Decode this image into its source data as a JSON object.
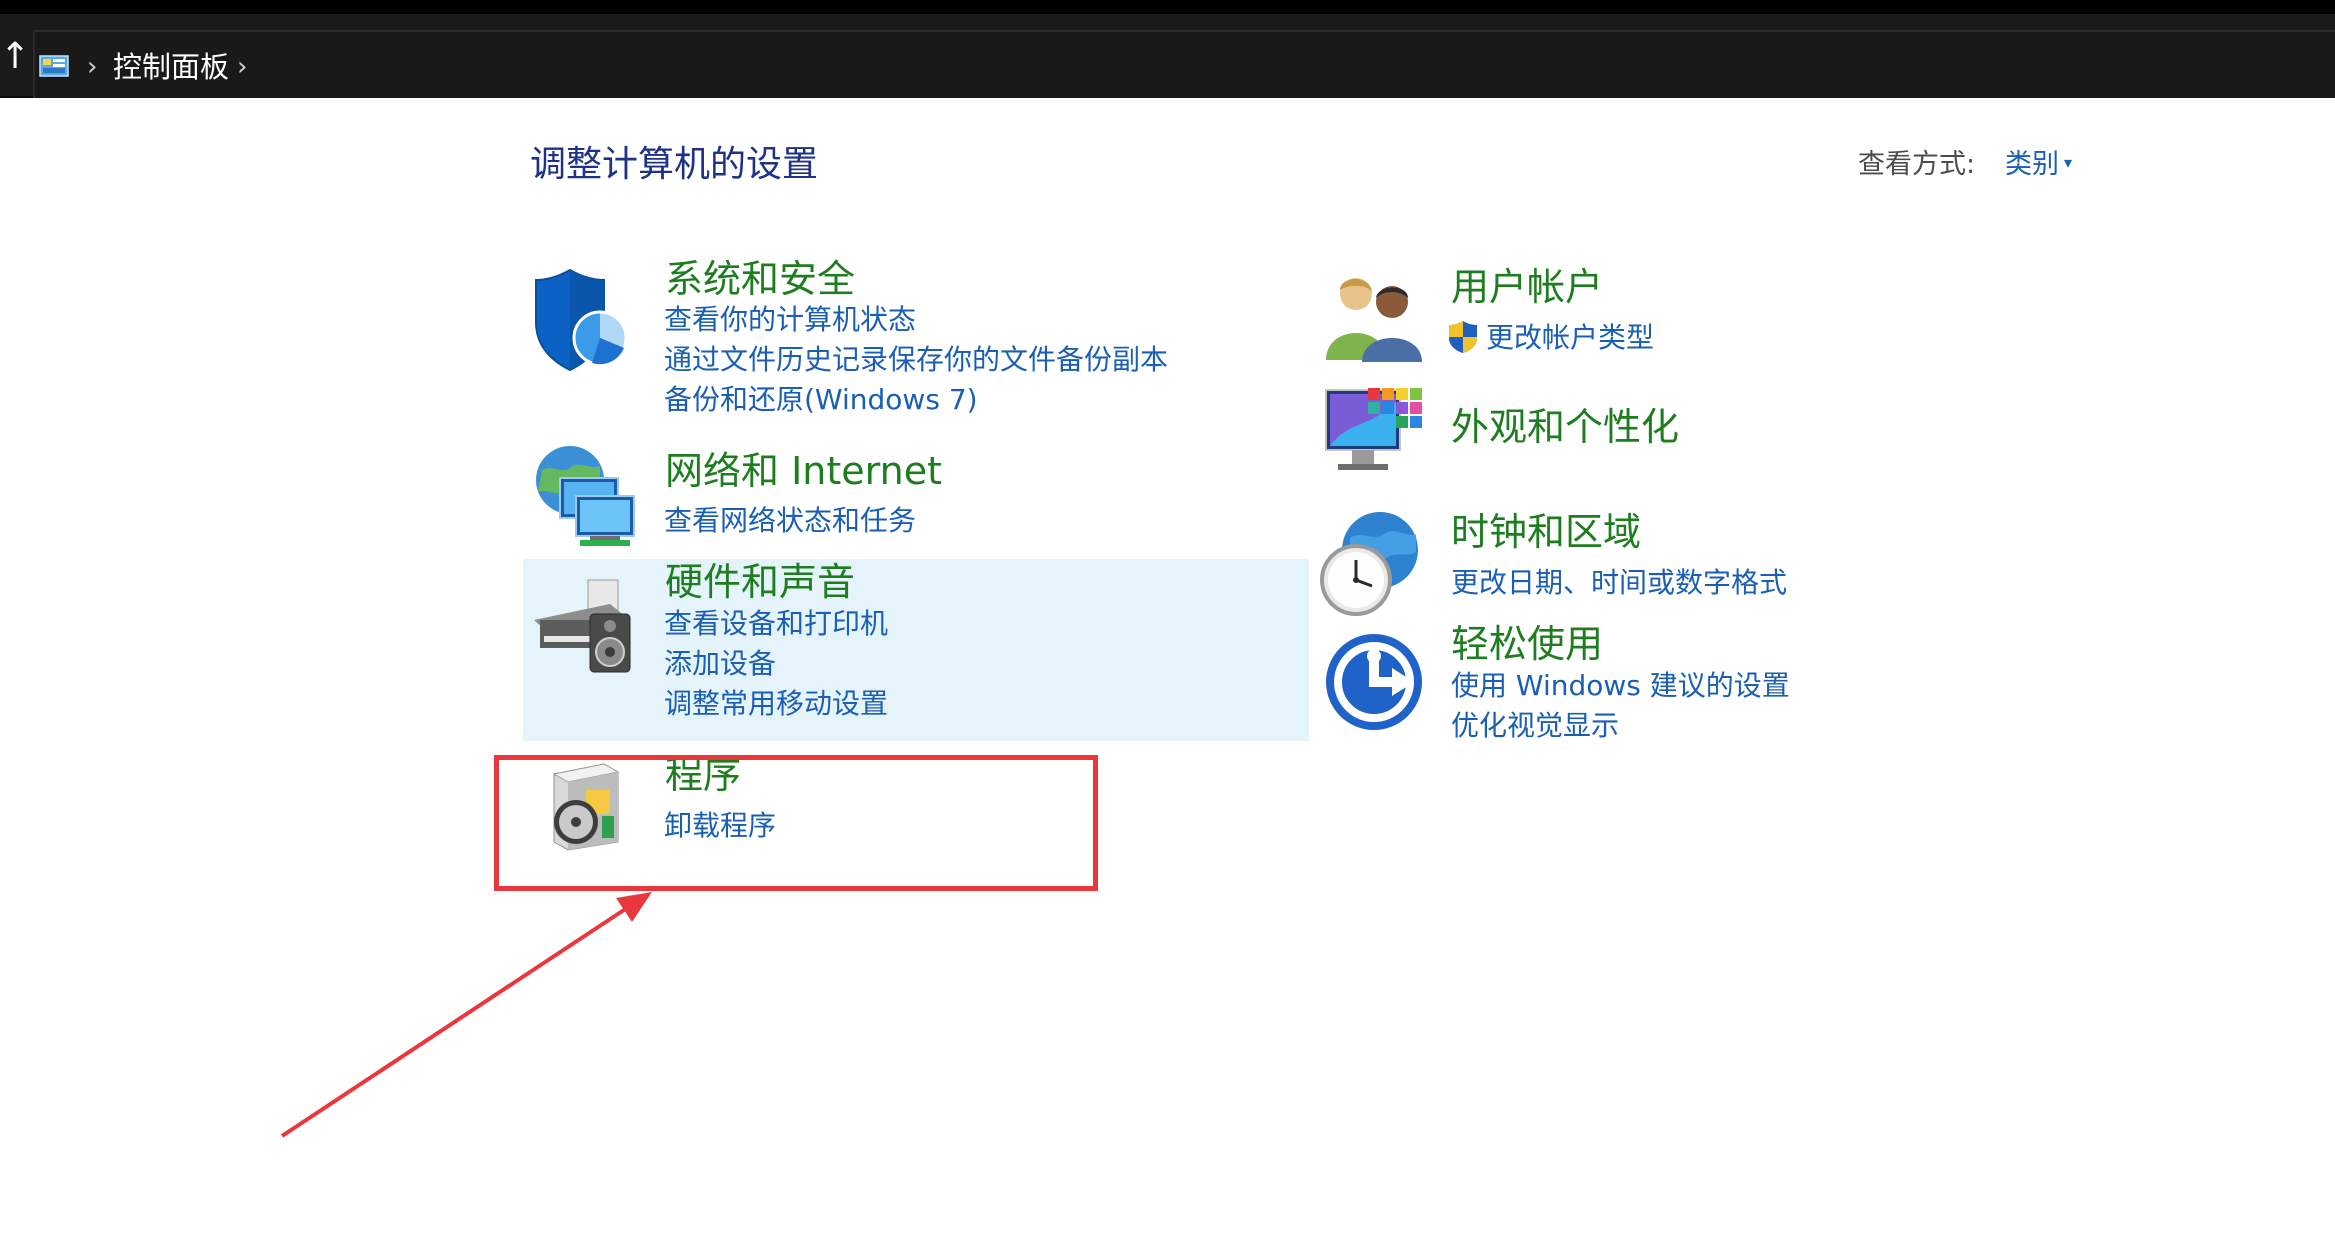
{
  "address_bar": {
    "breadcrumb": "控制面板",
    "up_icon": "up-arrow-icon",
    "separator_icon": "chevron-right-icon"
  },
  "page": {
    "title": "调整计算机的设置",
    "view_by_label": "查看方式:",
    "view_by_value": "类别",
    "view_by_caret": "▾"
  },
  "categories": {
    "system_security": {
      "title": "系统和安全",
      "icon": "shield-icon",
      "links": [
        "查看你的计算机状态",
        "通过文件历史记录保存你的文件备份副本",
        "备份和还原(Windows 7)"
      ]
    },
    "network": {
      "title": "网络和 Internet",
      "icon": "network-globe-icon",
      "links": [
        "查看网络状态和任务"
      ]
    },
    "hardware": {
      "title": "硬件和声音",
      "icon": "printer-speaker-icon",
      "links": [
        "查看设备和打印机",
        "添加设备",
        "调整常用移动设置"
      ]
    },
    "programs": {
      "title": "程序",
      "icon": "program-disc-icon",
      "links": [
        "卸载程序"
      ]
    },
    "user_accounts": {
      "title": "用户帐户",
      "icon": "users-icon",
      "links": [
        "更改帐户类型"
      ],
      "link_icon": "uac-shield-icon"
    },
    "appearance": {
      "title": "外观和个性化",
      "icon": "monitor-palette-icon",
      "links": []
    },
    "clock_region": {
      "title": "时钟和区域",
      "icon": "clock-globe-icon",
      "links": [
        "更改日期、时间或数字格式"
      ]
    },
    "ease_access": {
      "title": "轻松使用",
      "icon": "ease-of-access-icon",
      "links": [
        "使用 Windows 建议的设置",
        "优化视觉显示"
      ]
    }
  },
  "annotations": {
    "highlight_color": "#e8383d"
  },
  "colors": {
    "title_blue": "#1e3287",
    "category_green": "#1e7d1e",
    "link_blue": "#1a5fb4",
    "hover_bg": "#e5f3fb"
  }
}
